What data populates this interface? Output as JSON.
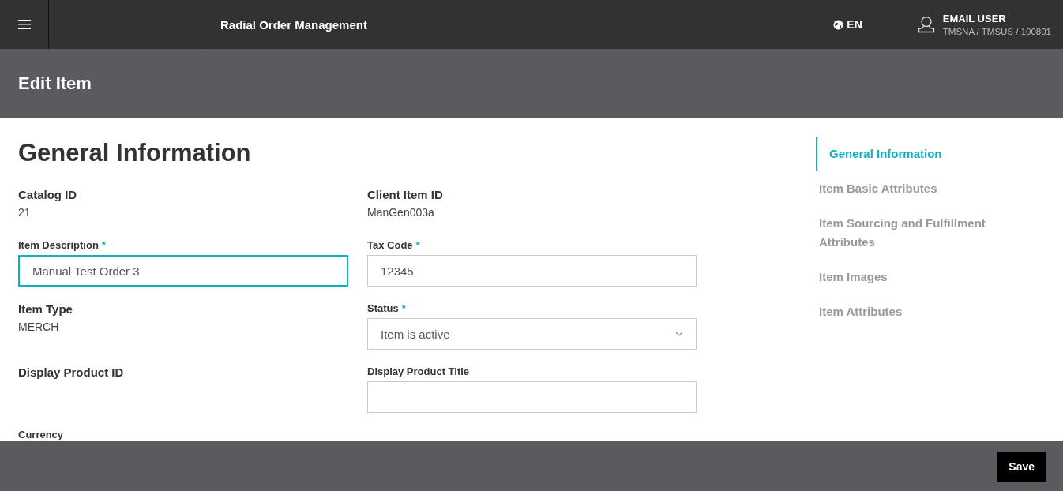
{
  "header": {
    "app_title": "Radial Order Management",
    "language": "EN",
    "user_name": "EMAIL USER",
    "user_org": "TMSNA / TMSUS / 100801"
  },
  "page_title": "Edit Item",
  "section_title": "General Information",
  "fields": [
    {
      "kind": "text",
      "label": "Catalog ID",
      "value": "21"
    },
    {
      "kind": "text",
      "label": "Client Item ID",
      "value": "ManGen003a"
    },
    {
      "kind": "input",
      "label": "Item Description",
      "required_mark": "*",
      "value": "Manual Test Order 3",
      "focused": true
    },
    {
      "kind": "input",
      "label": "Tax Code",
      "required_mark": "*",
      "value": "12345",
      "focused": false
    },
    {
      "kind": "text",
      "label": "Item Type",
      "value": "MERCH"
    },
    {
      "kind": "select",
      "label": "Status",
      "required_mark": "*",
      "value": "Item is active"
    },
    {
      "kind": "text",
      "label": "Display Product ID"
    },
    {
      "kind": "input",
      "label": "Display Product Title",
      "focused": false
    },
    {
      "kind": "label",
      "label": "Currency"
    }
  ],
  "nav": [
    {
      "label": "General Information",
      "selected": true
    },
    {
      "label": "Item Basic Attributes",
      "selected": false
    },
    {
      "label": "Item Sourcing and Fulfillment Attributes",
      "selected": false
    },
    {
      "label": "Item Images",
      "selected": false
    },
    {
      "label": "Item Attributes",
      "selected": false
    }
  ],
  "footer": {
    "save_label": "Save"
  }
}
